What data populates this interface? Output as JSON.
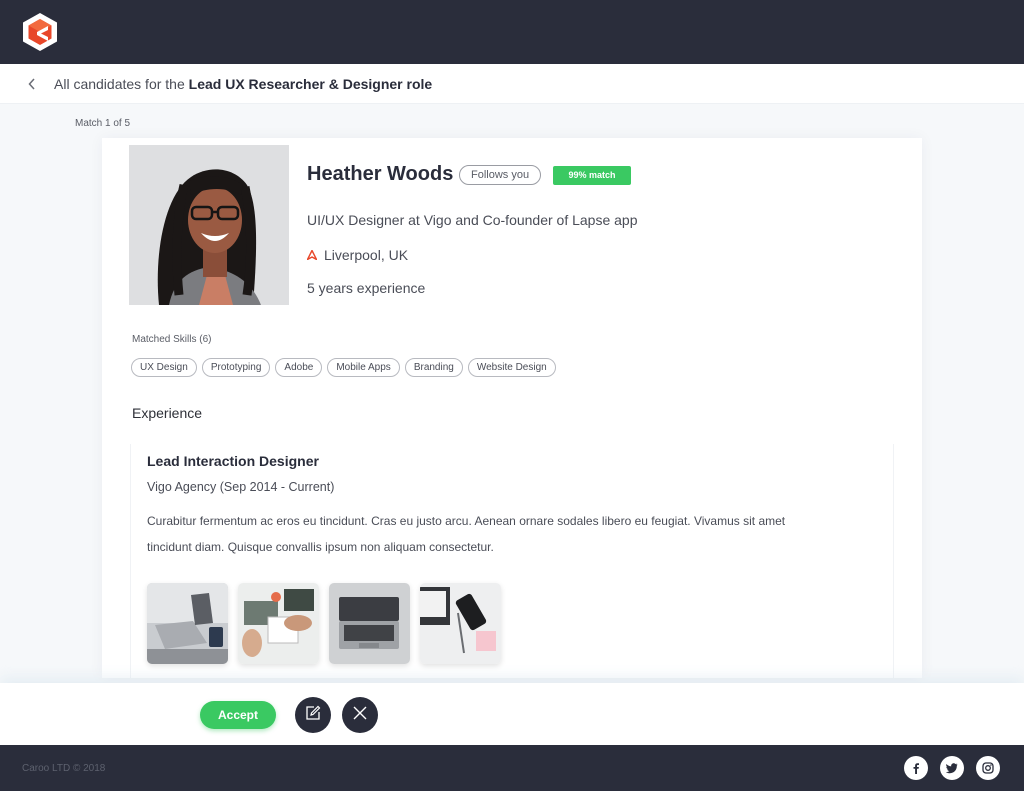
{
  "header": {
    "breadcrumb_prefix": "All candidates for the",
    "breadcrumb_role": "Lead UX Researcher & Designer role"
  },
  "match_counter": "Match 1 of 5",
  "candidate": {
    "name": "Heather Woods",
    "follows_label": "Follows you",
    "match_label": "99% match",
    "headline": "UI/UX Designer at Vigo and Co-founder of Lapse app",
    "location": "Liverpool, UK",
    "experience_years": "5 years experience"
  },
  "skills": {
    "label": "Matched Skills (6)",
    "items": [
      "UX Design",
      "Prototyping",
      "Adobe",
      "Mobile Apps",
      "Branding",
      "Website Design"
    ]
  },
  "experience": {
    "heading": "Experience",
    "jobs": [
      {
        "title": "Lead Interaction Designer",
        "company": "Vigo Agency (Sep 2014 - Current)",
        "description": "Curabitur fermentum ac eros eu tincidunt. Cras eu justo arcu. Aenean ornare sodales libero eu feugiat. Vivamus sit amet tincidunt diam. Quisque convallis ipsum non aliquam consectetur."
      }
    ]
  },
  "actions": {
    "accept_label": "Accept",
    "edit_icon": "edit-icon",
    "reject_icon": "close-icon"
  },
  "footer": {
    "copyright": "Caroo LTD © 2018",
    "social": [
      "facebook-icon",
      "twitter-icon",
      "instagram-icon"
    ]
  },
  "colors": {
    "dark": "#2a2d3b",
    "accent_green": "#3ac962",
    "logo_red": "#e8472a"
  }
}
